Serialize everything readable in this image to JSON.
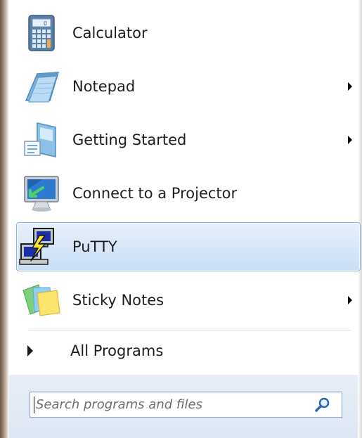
{
  "start_menu": {
    "programs": [
      {
        "label": "Calculator",
        "icon": "calculator-icon",
        "has_submenu": false,
        "highlighted": false
      },
      {
        "label": "Notepad",
        "icon": "notepad-icon",
        "has_submenu": true,
        "highlighted": false
      },
      {
        "label": "Getting Started",
        "icon": "getting-started-icon",
        "has_submenu": true,
        "highlighted": false
      },
      {
        "label": "Connect to a Projector",
        "icon": "projector-icon",
        "has_submenu": false,
        "highlighted": false
      },
      {
        "label": "PuTTY",
        "icon": "putty-icon",
        "has_submenu": false,
        "highlighted": true
      },
      {
        "label": "Sticky Notes",
        "icon": "sticky-notes-icon",
        "has_submenu": true,
        "highlighted": false
      }
    ],
    "all_programs_label": "All Programs",
    "search": {
      "placeholder": "Search programs and files",
      "value": ""
    }
  },
  "colors": {
    "highlight_bg": "#d9e8f8",
    "highlight_border": "#8db2de",
    "search_area_bg": "#e2eaf5",
    "text": "#1e1e1e"
  }
}
